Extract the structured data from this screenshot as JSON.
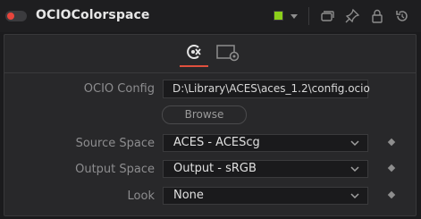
{
  "header": {
    "title": "OCIOColorspace",
    "enabled": true,
    "swatch_color": "#8ccf1a",
    "icons": [
      "versions-icon",
      "pin-icon",
      "lock-icon",
      "reset-icon"
    ]
  },
  "tabs": [
    {
      "name": "controls",
      "icon": "ocio-controls-icon",
      "active": true
    },
    {
      "name": "settings",
      "icon": "settings-icon",
      "active": false
    }
  ],
  "fields": {
    "ocio_config": {
      "label": "OCIO Config",
      "value": "D:\\Library\\ACES\\aces_1.2\\config.ocio"
    },
    "browse_label": "Browse",
    "source_space": {
      "label": "Source Space",
      "value": "ACES - ACEScg"
    },
    "output_space": {
      "label": "Output Space",
      "value": "Output - sRGB"
    },
    "look": {
      "label": "Look",
      "value": "None"
    }
  }
}
